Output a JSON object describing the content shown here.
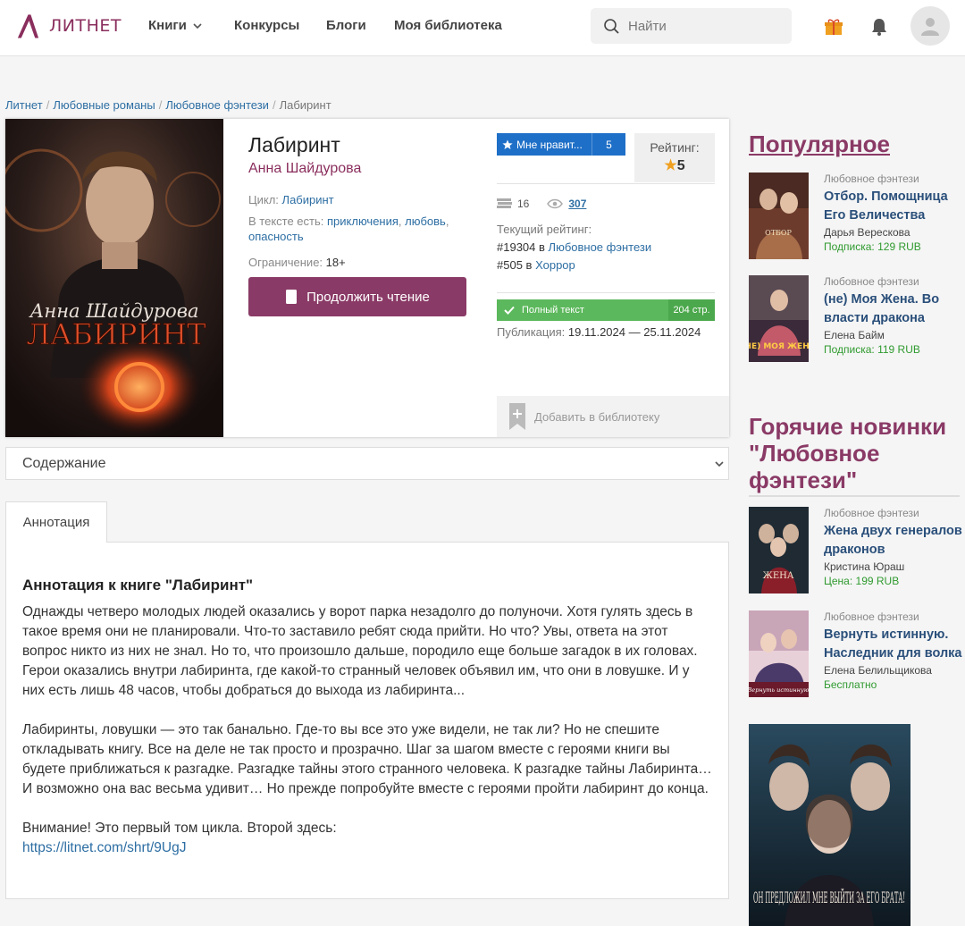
{
  "header": {
    "logo_text": "ЛИТНЕТ",
    "nav": [
      "Книги",
      "Конкурсы",
      "Блоги",
      "Моя библиотека"
    ],
    "search_placeholder": "Найти"
  },
  "breadcrumbs": [
    "Литнет",
    "Любовные романы",
    "Любовное фэнтези",
    "Лабиринт"
  ],
  "book": {
    "cover_author": "Анна Шайдурова",
    "cover_title": "ЛАБИРИНТ",
    "title": "Лабиринт",
    "author": "Анна Шайдурова",
    "cycle_label": "Цикл:",
    "cycle": "Лабиринт",
    "tags_label": "В тексте есть:",
    "tags": [
      "приключения",
      "любовь",
      "опасность"
    ],
    "restriction_label": "Ограничение:",
    "restriction": "18+",
    "read_button": "Продолжить чтение",
    "like_label": "Мне нравит...",
    "like_count": "5",
    "rating_label": "Рейтинг:",
    "rating_value": "5",
    "stat_books": "16",
    "stat_views": "307",
    "current_rating_label": "Текущий рейтинг:",
    "rank1_pos": "#19304 в",
    "rank1_genre": "Любовное фэнтези",
    "rank2_pos": "#505 в",
    "rank2_genre": "Хоррор",
    "full_text": "Полный текст",
    "pages": "204 стр.",
    "pub_label": "Публикация:",
    "pub_dates": "19.11.2024 — 25.11.2024",
    "add_library": "Добавить в библиотеку"
  },
  "contents_label": "Содержание",
  "tab_label": "Аннотация",
  "annotation": {
    "heading": "Аннотация к книге \"Лабиринт\"",
    "p1": "Однажды четверо молодых людей оказались у ворот парка незадолго до полуночи. Хотя гулять здесь в такое время они не планировали. Что-то заставило ребят сюда прийти. Но что? Увы, ответа на этот вопрос никто из них не знал. Но то, что произошло дальше, породило еще больше загадок в их головах. Герои оказались внутри лабиринта, где какой-то странный человек объявил им, что они в ловушке. И у них есть лишь 48 часов, чтобы добраться до выхода из лабиринта...",
    "p2": "Лабиринты, ловушки — это так банально. Где-то вы все это уже видели, не так ли? Но не спешите откладывать книгу. Все на деле не так просто и прозрачно. Шаг за шагом вместе с героями книги вы будете приближаться к разгадке. Разгадке тайны этого странного человека. К разгадке тайны Лабиринта… И возможно она вас весьма удивит… Но прежде попробуйте вместе с героями пройти лабиринт до конца.",
    "p3": "Внимание! Это первый том цикла. Второй здесь:",
    "link": "https://litnet.com/shrt/9UgJ"
  },
  "sidebar": {
    "popular_heading": "Популярное",
    "hot_heading": "Горячие новинки \"Любовное фэнтези\"",
    "popular": [
      {
        "genre": "Любовное фэнтези",
        "title": "Отбор. Помощница Его Величества",
        "author": "Дарья Верескова",
        "price": "Подписка: 129 RUB",
        "thumb_text": "ОТБОР"
      },
      {
        "genre": "Любовное фэнтези",
        "title": "(не) Моя Жена. Во власти дракона",
        "author": "Елена Байм",
        "price": "Подписка: 119 RUB",
        "thumb_text": "(НЕ) МОЯ ЖЕНА"
      }
    ],
    "hot": [
      {
        "genre": "Любовное фэнтези",
        "title": "Жена двух генералов драконов",
        "author": "Кристина Юраш",
        "price": "Цена: 199 RUB",
        "thumb_text": "ЖЕНА"
      },
      {
        "genre": "Любовное фэнтези",
        "title": "Вернуть истинную. Наследник для волка",
        "author": "Елена Белильщикова",
        "price": "Бесплатно",
        "thumb_text": "Вернуть истинную"
      }
    ],
    "ad_text": "ОН ПРЕДЛОЖИЛ МНЕ ВЫЙТИ ЗА ЕГО БРАТА!"
  },
  "colors": {
    "brand": "#8a3a66",
    "link": "#2d6ea3",
    "like": "#1e6fc7",
    "full_text": "#5cb85c",
    "price": "#2f9a2f"
  }
}
